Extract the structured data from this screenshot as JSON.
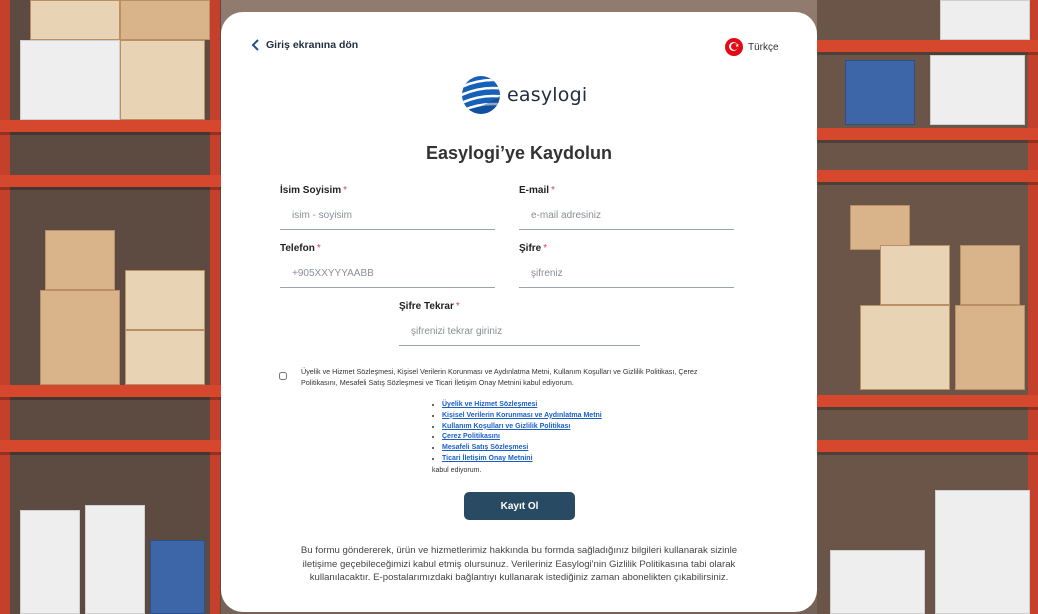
{
  "nav": {
    "back_label": "Giriş ekranına dön",
    "language_label": "Türkçe"
  },
  "brand": {
    "logo_text": "easylogi"
  },
  "title": "Easylogi’ye Kaydolun",
  "form": {
    "fields": [
      {
        "label": "İsim Soyisim",
        "required": "*",
        "placeholder": "isim - soyisim",
        "value": ""
      },
      {
        "label": "E-mail",
        "required": "*",
        "placeholder": "e-mail adresiniz",
        "value": ""
      },
      {
        "label": "Telefon",
        "required": "*",
        "placeholder": "+905XXYYYAABB",
        "value": ""
      },
      {
        "label": "Şifre",
        "required": "*",
        "placeholder": "şifreniz",
        "value": ""
      },
      {
        "label": "Şifre Tekrar",
        "required": "*",
        "placeholder": "şifrenizi tekrar giriniz",
        "value": ""
      }
    ],
    "consent_text": "Üyelik ve Hizmet Sözleşmesi, Kişisel Verilerin Korunması ve Aydınlatma Metni, Kullanım Koşulları ve Gizlilik Politikası, Çerez Politikasını, Mesafeli Satış Sözleşmesi ve Ticari İletişim Onay Metnini kabul ediyorum.",
    "consent_checked": false,
    "links": [
      "Üyelik ve Hizmet Sözleşmesi",
      "Kişisel Verilerin Korunması ve Aydınlatma Metni",
      "Kullanım Koşulları ve Gizlilik Politikası",
      "Çerez Politikasını",
      "Mesafeli Satış Sözleşmesi",
      "Ticari İletişim Onay Metnini"
    ],
    "links_tail": "kabul ediyorum.",
    "submit_label": "Kayıt Ol"
  },
  "footer_text": "Bu formu göndererek, ürün ve hizmetlerimiz hakkında bu formda sağladığınız bilgileri kullanarak sizinle iletişime geçebileceğimizi kabul etmiş olursunuz. Verileriniz Easylogi'nin Gizlilik Politikasına tabi olarak kullanılacaktır. E-postalarımızdaki bağlantıyı kullanarak istediğiniz zaman abonelikten çıkabilirsiniz.",
  "colors": {
    "primary": "#284b63",
    "link": "#1a5fc7",
    "required": "#e04343",
    "rack": "#d5482e"
  },
  "icons": {
    "back": "chevron-left-icon",
    "language": "turkey-flag-icon",
    "logo": "globe-logo-icon"
  }
}
